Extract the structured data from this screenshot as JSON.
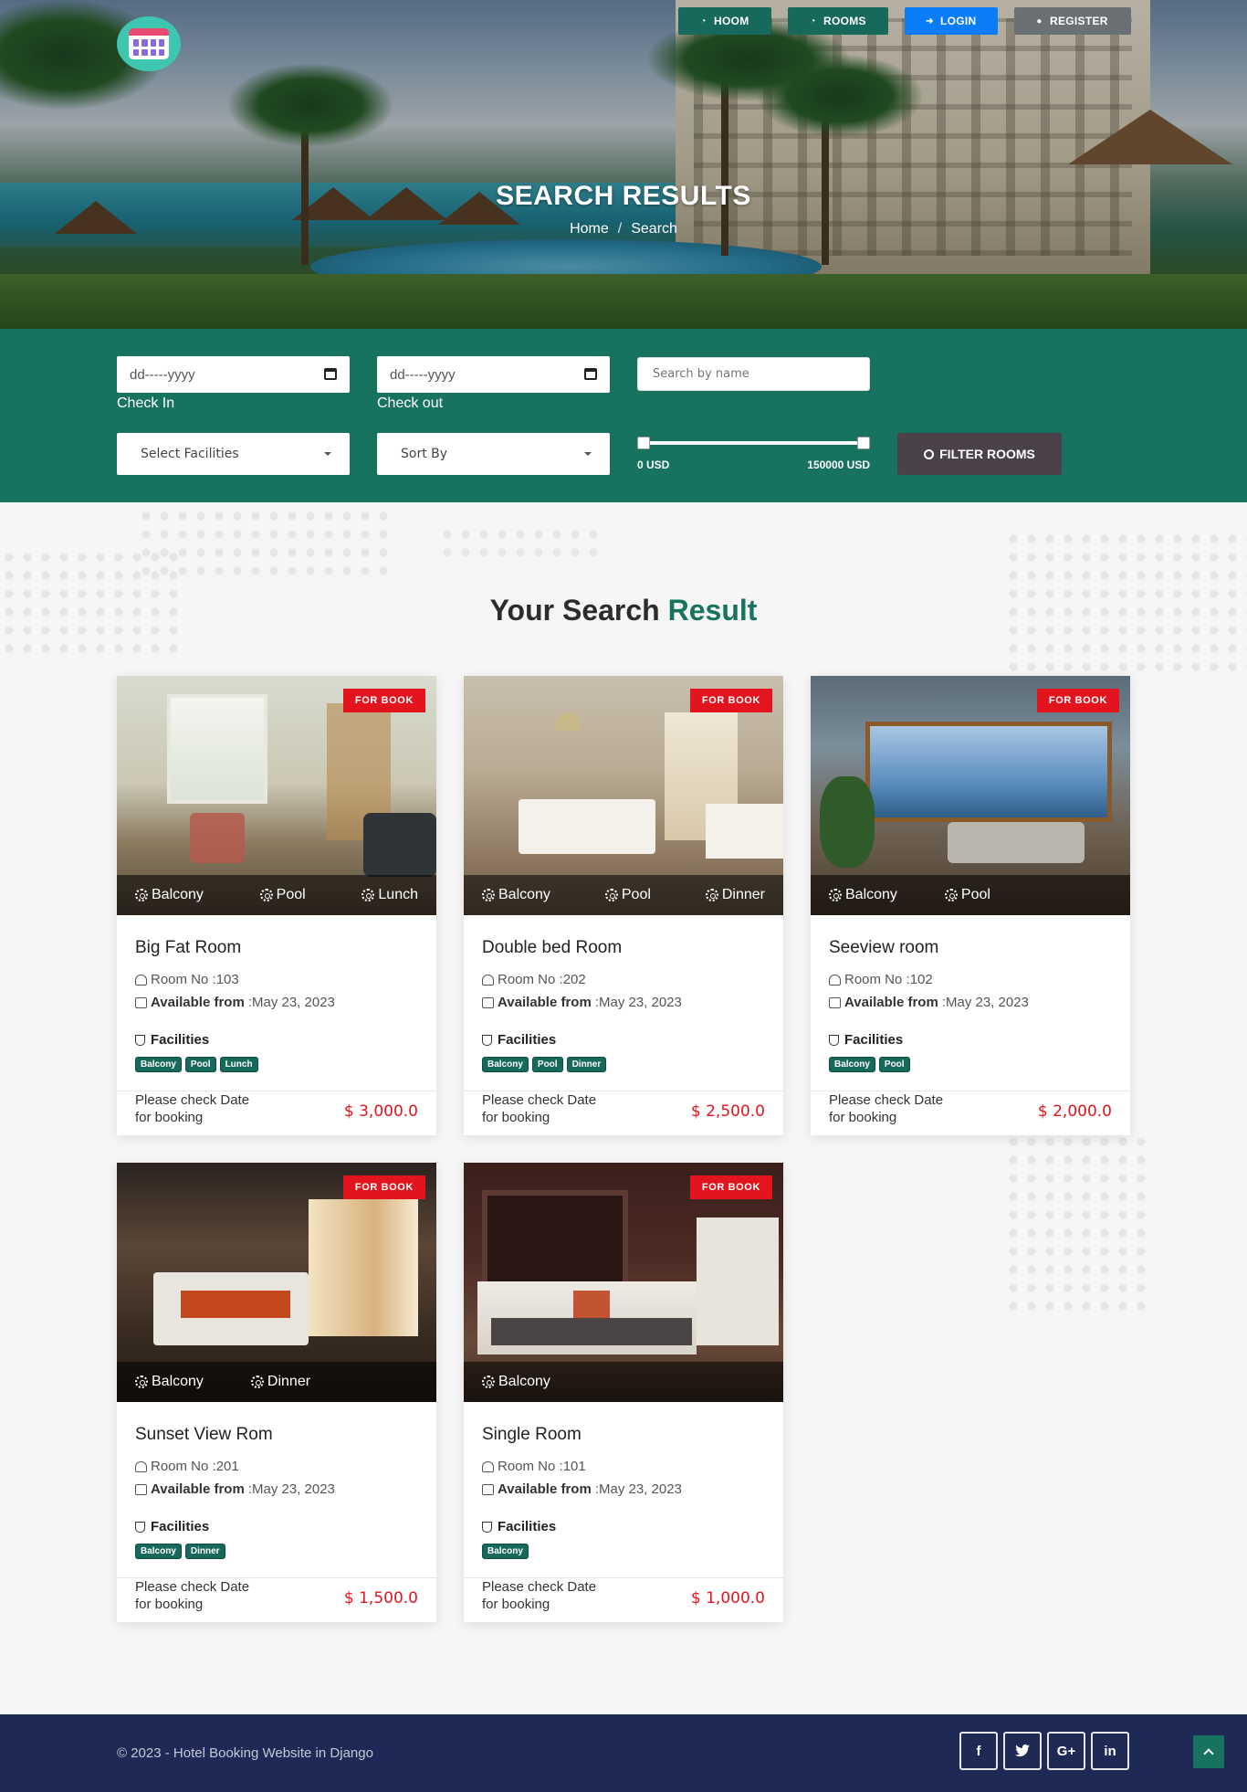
{
  "nav": {
    "home": "HOOM",
    "rooms": "ROOMS",
    "login": "LOGIN",
    "register": "REGISTER"
  },
  "hero": {
    "title": "SEARCH RESULTS",
    "crumb_home": "Home",
    "crumb_sep": "/",
    "crumb_current": "Search"
  },
  "search": {
    "checkin_value": "dd-----yyyy",
    "checkin_label": "Check In",
    "checkout_value": "dd-----yyyy",
    "checkout_label": "Check out",
    "name_placeholder": "Search by name",
    "facilities_select": "Select Facilities",
    "sort_select": "Sort By",
    "price_min": "0 USD",
    "price_max": "150000 USD",
    "filter_button": "FILTER ROOMS"
  },
  "results": {
    "title_a": "Your Search",
    "title_b": "Result"
  },
  "rooms": [
    {
      "badge": "FOR BOOK",
      "name": "Big Fat Room",
      "room_no": "Room No :103",
      "available_label": "Available from",
      "available_date": ":May 23, 2023",
      "facilities_label": "Facilities",
      "facilities": [
        "Balcony",
        "Pool",
        "Lunch"
      ],
      "note": "Please check Date for booking",
      "price": "$ 3,000.0"
    },
    {
      "badge": "FOR BOOK",
      "name": "Double bed Room",
      "room_no": "Room No :202",
      "available_label": "Available from",
      "available_date": ":May 23, 2023",
      "facilities_label": "Facilities",
      "facilities": [
        "Balcony",
        "Pool",
        "Dinner"
      ],
      "note": "Please check Date for booking",
      "price": "$ 2,500.0"
    },
    {
      "badge": "FOR BOOK",
      "name": "Seeview room",
      "room_no": "Room No :102",
      "available_label": "Available from",
      "available_date": ":May 23, 2023",
      "facilities_label": "Facilities",
      "facilities": [
        "Balcony",
        "Pool"
      ],
      "note": "Please check Date for booking",
      "price": "$ 2,000.0"
    },
    {
      "badge": "FOR BOOK",
      "name": "Sunset View Rom",
      "room_no": "Room No :201",
      "available_label": "Available from",
      "available_date": ":May 23, 2023",
      "facilities_label": "Facilities",
      "facilities": [
        "Balcony",
        "Dinner"
      ],
      "note": "Please check Date for booking",
      "price": "$ 1,500.0"
    },
    {
      "badge": "FOR BOOK",
      "name": "Single Room",
      "room_no": "Room No :101",
      "available_label": "Available from",
      "available_date": ":May 23, 2023",
      "facilities_label": "Facilities",
      "facilities": [
        "Balcony"
      ],
      "note": "Please check Date for booking",
      "price": "$ 1,000.0"
    }
  ],
  "footer": {
    "copyright": "© 2023 - Hotel Booking Website in Django",
    "social": [
      "f",
      "twitter",
      "G+",
      "in"
    ]
  },
  "colors": {
    "brand_green": "#17735f",
    "login_blue": "#0a7cf5",
    "register_gray": "#6b7075",
    "price_red": "#e3141e",
    "footer_navy": "#1e2a55"
  }
}
